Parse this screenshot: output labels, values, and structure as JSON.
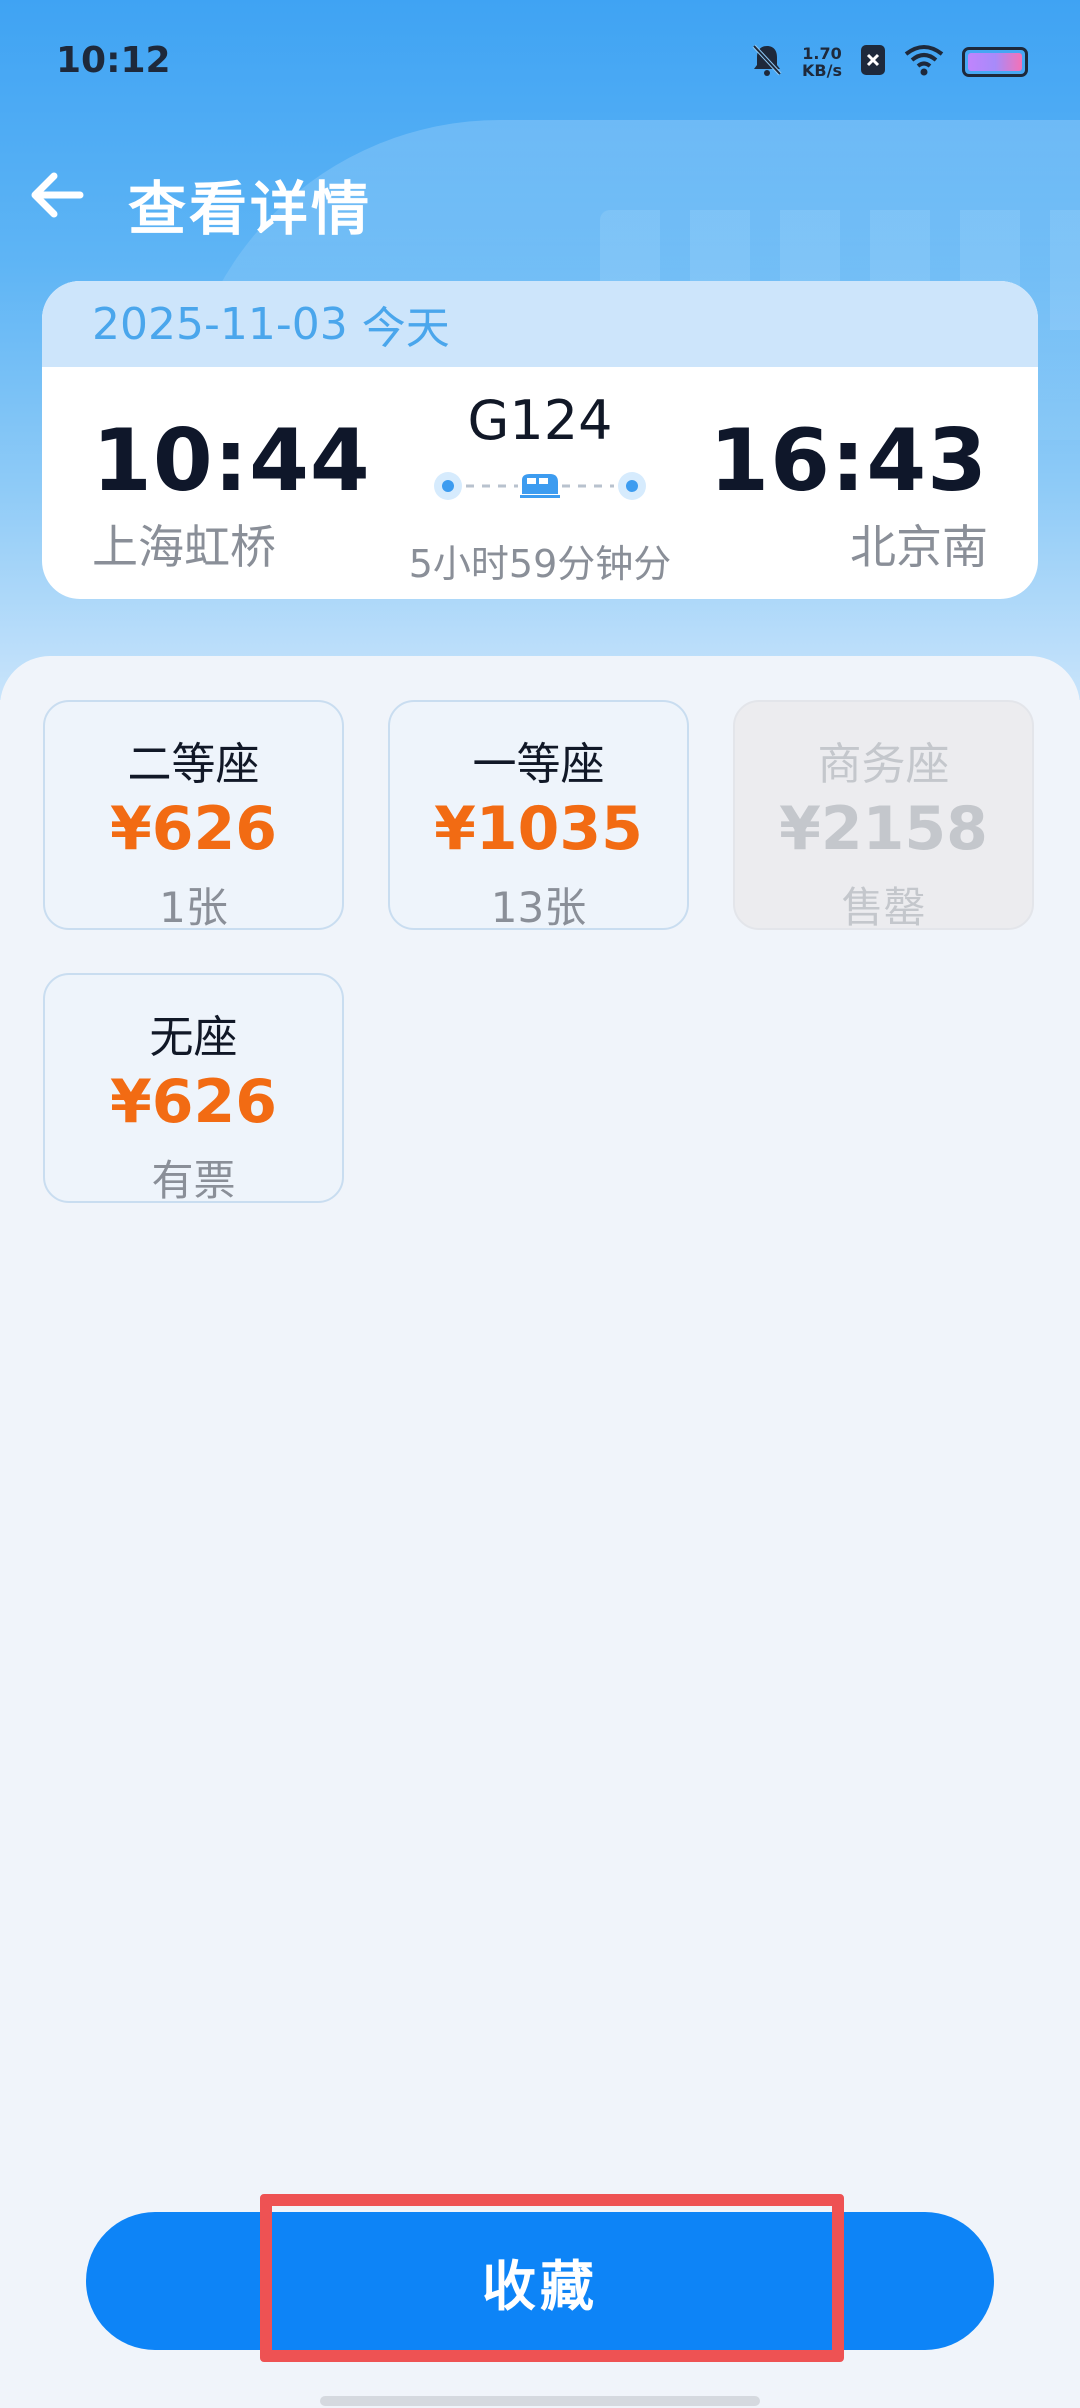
{
  "status_bar": {
    "time": "10:12",
    "net_speed_value": "1.70",
    "net_speed_unit": "KB/s",
    "icons": [
      "bell-off-icon",
      "sim-x-icon",
      "wifi-icon",
      "battery-icon"
    ]
  },
  "header": {
    "back_icon": "arrow-left-icon",
    "title": "查看详情"
  },
  "trip": {
    "date": "2025-11-03",
    "day_label": "今天",
    "depart_time": "10:44",
    "depart_station": "上海虹桥",
    "arrive_time": "16:43",
    "arrive_station": "北京南",
    "train_no": "G124",
    "duration": "5小时59分钟分"
  },
  "seats": [
    {
      "name": "二等座",
      "price": "¥626",
      "remain": "1张",
      "sold_out": false
    },
    {
      "name": "一等座",
      "price": "¥1035",
      "remain": "13张",
      "sold_out": false
    },
    {
      "name": "商务座",
      "price": "¥2158",
      "remain": "售罄",
      "sold_out": true
    },
    {
      "name": "无座",
      "price": "¥626",
      "remain": "有票",
      "sold_out": false
    }
  ],
  "actions": {
    "favorite_label": "收藏"
  },
  "colors": {
    "accent": "#0d84f7",
    "price": "#f26b13",
    "highlight": "#ee5253"
  }
}
